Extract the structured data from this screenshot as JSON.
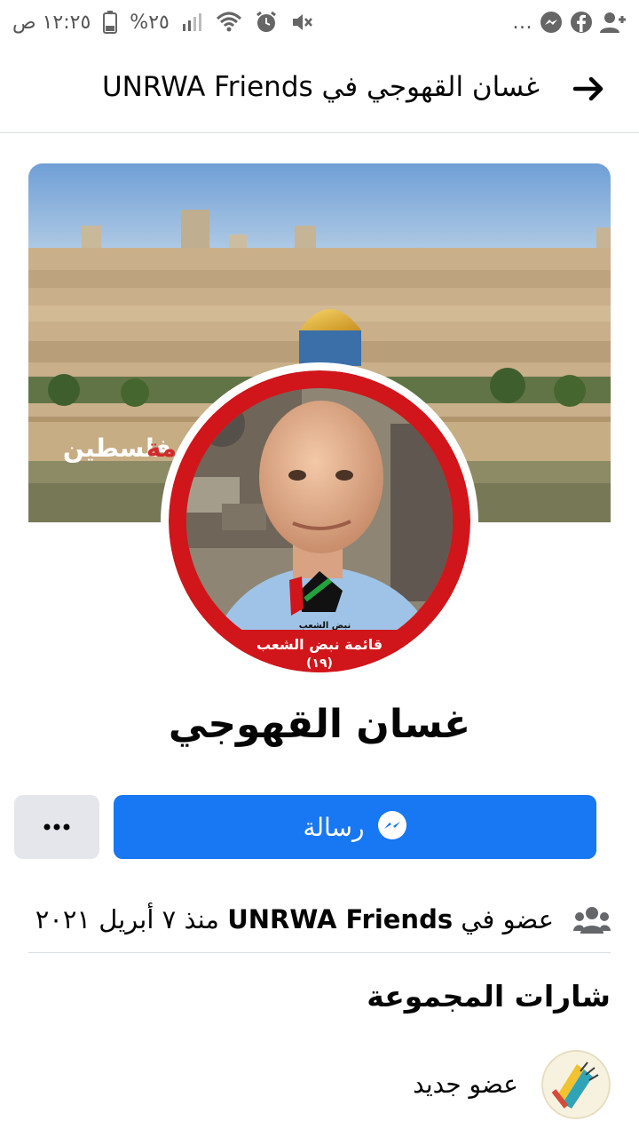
{
  "status_bar": {
    "time": "١٢:٢٥ ص",
    "battery": "%٢٥",
    "more": "..."
  },
  "header": {
    "title": "غسان القهوجي في UNRWA Friends",
    "back_icon": "arrow-forward-icon"
  },
  "cover": {
    "overlay_text": "فلسطين",
    "overlay_text_accent": "مة"
  },
  "avatar": {
    "banner_line1": "قائمة نبض الشعب",
    "banner_line2": "(١٩)",
    "logo_text": "نبض الشعب"
  },
  "profile": {
    "name": "غسان القهوجي"
  },
  "actions": {
    "message_label": "رسالة",
    "more_label": "..."
  },
  "membership": {
    "prefix": "عضو في ",
    "group": "UNRWA Friends",
    "suffix": " منذ ٧ أبريل ٢٠٢١"
  },
  "badges_section": {
    "title": "شارات المجموعة",
    "badges": [
      {
        "label": "عضو جديد",
        "icon": "waving-hand-icon"
      }
    ]
  },
  "colors": {
    "accent": "#1877f2",
    "secondary_button": "#e4e6eb",
    "avatar_border": "#d0161b"
  }
}
